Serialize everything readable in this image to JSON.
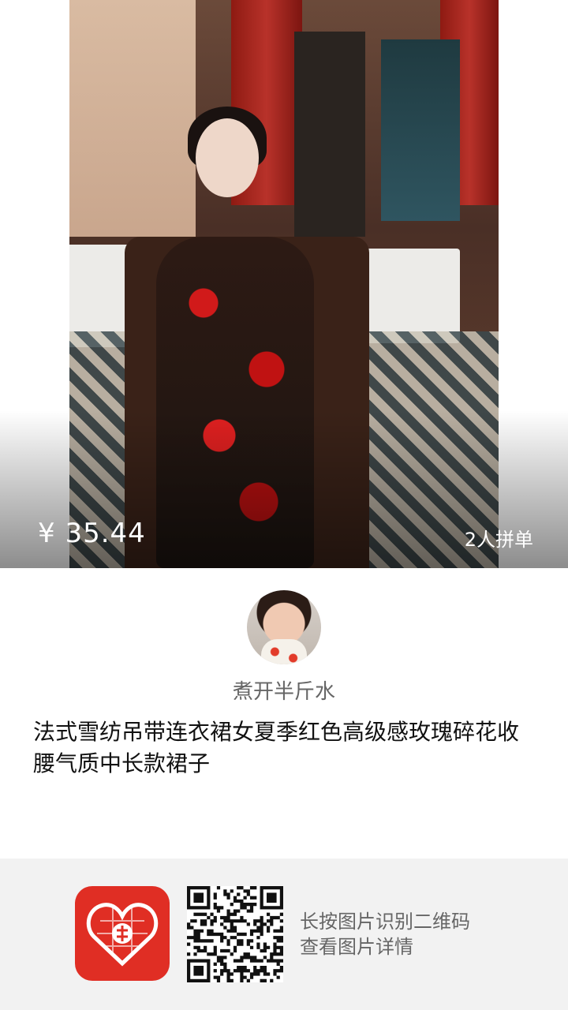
{
  "product": {
    "price": "¥ 35.44",
    "group_buy_label": "2人拼单",
    "title": "法式雪纺吊带连衣裙女夏季红色高级感玫瑰碎花收腰气质中长款裙子"
  },
  "seller": {
    "name": "煮开半斤水"
  },
  "footer": {
    "hint_line1": "长按图片识别二维码",
    "hint_line2": "查看图片详情"
  },
  "icons": {
    "app_logo": "pinduoduo-logo-icon",
    "qr": "qr-code"
  },
  "colors": {
    "brand_red": "#e02e24",
    "footer_bg": "#f2f2f2",
    "text_gray": "#666666"
  }
}
